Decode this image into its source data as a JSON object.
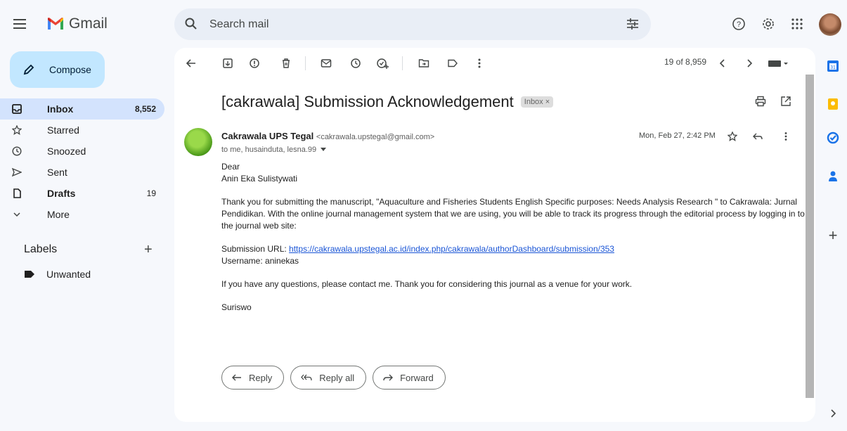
{
  "app": {
    "name": "Gmail"
  },
  "search": {
    "placeholder": "Search mail"
  },
  "compose": {
    "label": "Compose"
  },
  "nav": {
    "items": [
      {
        "label": "Inbox",
        "count": "8,552",
        "icon": "inbox-icon"
      },
      {
        "label": "Starred",
        "count": "",
        "icon": "star-icon"
      },
      {
        "label": "Snoozed",
        "count": "",
        "icon": "clock-icon"
      },
      {
        "label": "Sent",
        "count": "",
        "icon": "send-icon"
      },
      {
        "label": "Drafts",
        "count": "19",
        "icon": "draft-icon"
      },
      {
        "label": "More",
        "count": "",
        "icon": "chevron-down-icon"
      }
    ]
  },
  "labels": {
    "heading": "Labels",
    "items": [
      {
        "label": "Unwanted"
      }
    ]
  },
  "toolbar": {
    "pager": "19 of 8,959"
  },
  "message": {
    "subject": "[cakrawala] Submission Acknowledgement",
    "badge": "Inbox ×",
    "sender_name": "Cakrawala UPS Tegal",
    "sender_email": "<cakrawala.upstegal@gmail.com>",
    "recipients": "to me, husainduta, lesna.99",
    "date": "Mon, Feb 27, 2:42 PM",
    "greeting1": "Dear",
    "greeting2": "Anin Eka Sulistywati",
    "para1": "Thank you for submitting the manuscript, \"Aquaculture and Fisheries Students English Specific purposes: Needs Analysis Research \" to Cakrawala: Jurnal Pendidikan. With the online journal management system that we are using, you will be able to track its progress through the editorial process by logging in to the journal web site:",
    "url_label": "Submission URL: ",
    "url": "https://cakrawala.upstegal.ac.id/index.php/cakrawala/authorDashboard/submission/353",
    "username": "Username: aninekas",
    "para2": "If you have any questions, please contact me. Thank you for considering this journal as a venue for your work.",
    "signature": "Suriswo"
  },
  "actions": {
    "reply": "Reply",
    "reply_all": "Reply all",
    "forward": "Forward"
  },
  "colors": {
    "accent": "#c2e7ff",
    "active": "#d3e3fd",
    "link": "#1a55d6"
  }
}
